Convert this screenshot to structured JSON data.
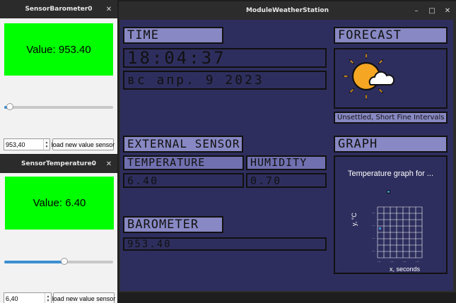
{
  "main_window": {
    "title": "ModuleWeatherStation",
    "controls": {
      "minimize": "–",
      "maximize": "□",
      "close": "✕"
    },
    "time": {
      "label": "TIME",
      "clock": "18:04:37",
      "date": "вс апр. 9 2023"
    },
    "forecast": {
      "label": "FORECAST",
      "icon": "sun-behind-cloud-icon",
      "text": "Unsettled, Short Fine Intervals"
    },
    "external_sensor": {
      "label": "EXTERNAL SENSOR",
      "temperature_label": "TEMPERATURE",
      "temperature_value": "6.40",
      "humidity_label": "HUMIDITY",
      "humidity_value": "0.70"
    },
    "barometer": {
      "label": "BAROMETER",
      "value": "953.40"
    },
    "graph": {
      "label": "GRAPH",
      "chart_title": "Temperature graph for ...",
      "xlabel": "x, seconds",
      "ylabel": "y, °C"
    }
  },
  "barometer_window": {
    "title": "SensorBarometer0",
    "controls": {
      "close": "✕"
    },
    "display": "Value: 953.40",
    "slider_fraction": 0.05,
    "spin_value": "953,40",
    "button": "load new value sensor"
  },
  "temperature_window": {
    "title": "SensorTemperature0",
    "controls": {
      "minimize": "–",
      "close": "✕"
    },
    "display": "Value: 6.40",
    "slider_fraction": 0.55,
    "spin_value": "6,40",
    "button": "load new value sensor"
  },
  "colors": {
    "background": "#2e2e5e",
    "label_fill": "#8888c4",
    "sensor_display": "#00ff00",
    "slider_accent": "#3d8fd1"
  }
}
